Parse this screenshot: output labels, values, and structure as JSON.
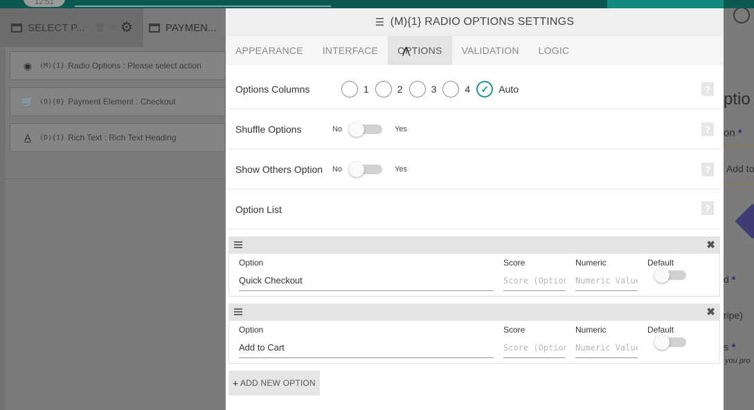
{
  "topbar": {
    "pill_text": "12:51"
  },
  "left_panel": {
    "tabs": [
      {
        "label": "SELECT P...",
        "icon": "window-icon"
      },
      {
        "label": "PAYMEN...",
        "icon": "window-icon"
      }
    ],
    "tab_icons": [
      "trash-icon",
      "copy-icon",
      "gear-icon"
    ],
    "items": [
      {
        "code": "(M){1}",
        "text": "Radio Options : Please select action",
        "icon": "radio-icon"
      },
      {
        "code": "(O){0}",
        "text": "Payment Element : Checkout",
        "icon": "cart-icon"
      },
      {
        "code": "(D){1}",
        "text": "Rich Text : Rich Text Heading",
        "icon": "text-format-icon"
      }
    ]
  },
  "right_panel": {
    "title_fragment": "ptio",
    "on_fragment": "on",
    "addto_fragment": "Add to",
    "d_fragment": "d",
    "ripe_fragment": "ripe)",
    "s_fragment": "s",
    "youp_fragment": "you pro",
    "required_mark": "*"
  },
  "modal": {
    "title": "(M){1} RADIO OPTIONS SETTINGS",
    "tabs": [
      {
        "label": "APPEARANCE",
        "active": false
      },
      {
        "label": "INTERFACE",
        "active": false
      },
      {
        "label": "OPTIONS",
        "active": true
      },
      {
        "label": "VALIDATION",
        "active": false
      },
      {
        "label": "LOGIC",
        "active": false
      }
    ],
    "help_glyph": "?",
    "options_columns": {
      "label": "Options Columns",
      "choices": [
        "1",
        "2",
        "3",
        "4",
        "Auto"
      ],
      "selected": "Auto"
    },
    "shuffle": {
      "label": "Shuffle Options",
      "no": "No",
      "yes": "Yes",
      "on": false
    },
    "show_others": {
      "label": "Show Others Option",
      "no": "No",
      "yes": "Yes",
      "on": false
    },
    "option_list": {
      "label": "Option List"
    },
    "field_labels": {
      "option": "Option",
      "score": "Score",
      "numeric": "Numeric",
      "default": "Default"
    },
    "placeholders": {
      "score": "Score (Optional)",
      "numeric": "Numeric Value"
    },
    "options": [
      {
        "option": "Quick Checkout",
        "score": "",
        "numeric": "",
        "default": false
      },
      {
        "option": "Add to Cart",
        "score": "",
        "numeric": "",
        "default": false
      }
    ],
    "add_button": "ADD NEW OPTION"
  },
  "colors": {
    "accent": "#17968a",
    "topbar": "#0b5a52",
    "overlay": "#7b7b7b"
  }
}
